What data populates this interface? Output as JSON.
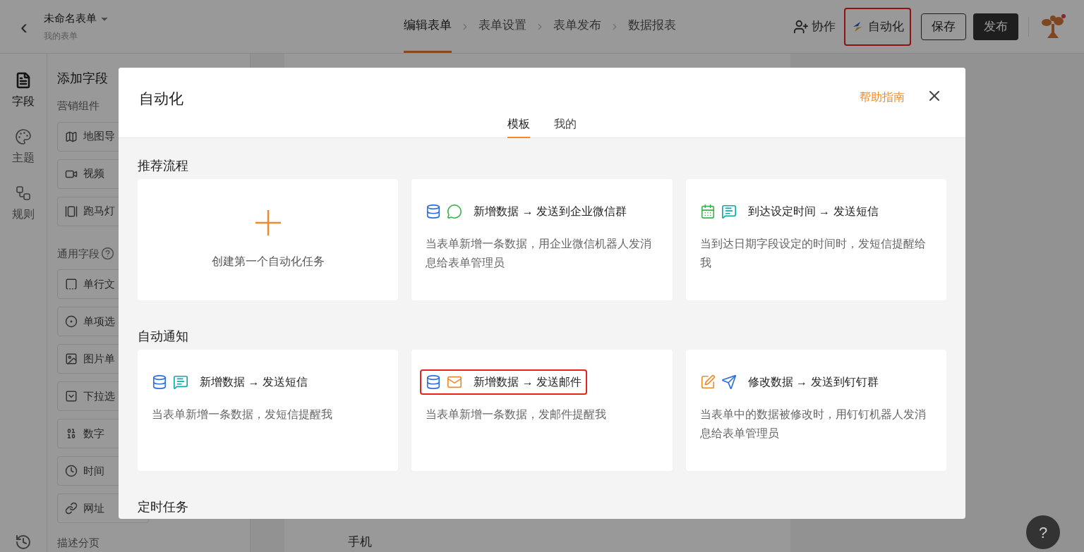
{
  "header": {
    "back": "‹",
    "form_title": "未命名表单",
    "form_subtitle": "我的表单",
    "steps": [
      {
        "label": "编辑表单",
        "selected": true
      },
      {
        "label": "表单设置",
        "selected": false
      },
      {
        "label": "表单发布",
        "selected": false
      },
      {
        "label": "数据报表",
        "selected": false
      }
    ],
    "collab": "协作",
    "automation": {
      "label": "自动化",
      "highlighted": true
    },
    "save": "保存",
    "publish": "发布"
  },
  "rail": [
    {
      "kind": "field",
      "label": "字段",
      "selected": true
    },
    {
      "kind": "theme",
      "label": "主题",
      "selected": false
    },
    {
      "kind": "rule",
      "label": "规则",
      "selected": false
    }
  ],
  "field_panel": {
    "title": "添加字段",
    "groups": [
      {
        "title": "营销组件",
        "items": [
          {
            "kind": "map",
            "label": "地图导"
          },
          {
            "kind": "video",
            "label": "视频"
          },
          {
            "kind": "carousel",
            "label": "跑马灯"
          }
        ]
      },
      {
        "title": "通用字段",
        "help": true,
        "items": [
          {
            "kind": "text",
            "label": "单行文"
          },
          {
            "kind": "radio",
            "label": "单项选"
          },
          {
            "kind": "image",
            "label": "图片单"
          },
          {
            "kind": "select",
            "label": "下拉选"
          },
          {
            "kind": "number",
            "label": "数字"
          },
          {
            "kind": "time",
            "label": "时间"
          },
          {
            "kind": "link",
            "label": "网址"
          }
        ]
      }
    ],
    "footer": "描述分页"
  },
  "canvas": {
    "label": "手机"
  },
  "modal": {
    "title": "自动化",
    "help_link": "帮助指南",
    "tabs": [
      {
        "label": "模板",
        "selected": true
      },
      {
        "label": "我的",
        "selected": false
      }
    ],
    "sections": [
      {
        "title": "推荐流程",
        "cards": [
          {
            "kind": "create",
            "title": "创建第一个自动化任务"
          },
          {
            "kind": "template",
            "icons": [
              {
                "kind": "database"
              },
              {
                "kind": "wechat"
              }
            ],
            "title": "新增数据 → 发送到企业微信群",
            "description": "当表单新增一条数据，用企业微信机器人发消息给表单管理员",
            "highlighted": false
          },
          {
            "kind": "template",
            "icons": [
              {
                "kind": "calendar"
              },
              {
                "kind": "sms"
              }
            ],
            "title": "到达设定时间 → 发送短信",
            "description": "当到达日期字段设定的时间时，发短信提醒给我",
            "highlighted": false
          }
        ]
      },
      {
        "title": "自动通知",
        "cards": [
          {
            "kind": "template",
            "icons": [
              {
                "kind": "database"
              },
              {
                "kind": "sms"
              }
            ],
            "title": "新增数据 → 发送短信",
            "description": "当表单新增一条数据，发短信提醒我",
            "highlighted": false
          },
          {
            "kind": "template",
            "icons": [
              {
                "kind": "database"
              },
              {
                "kind": "mail"
              }
            ],
            "title": "新增数据 → 发送邮件",
            "description": "当表单新增一条数据，发邮件提醒我",
            "highlighted": true
          },
          {
            "kind": "template",
            "icons": [
              {
                "kind": "edit"
              },
              {
                "kind": "dingtalk"
              }
            ],
            "title": "修改数据 → 发送到钉钉群",
            "description": "当表单中的数据被修改时，用钉钉机器人发消息给表单管理员",
            "highlighted": false
          }
        ]
      },
      {
        "title": "定时任务"
      }
    ]
  },
  "help_button": "?"
}
